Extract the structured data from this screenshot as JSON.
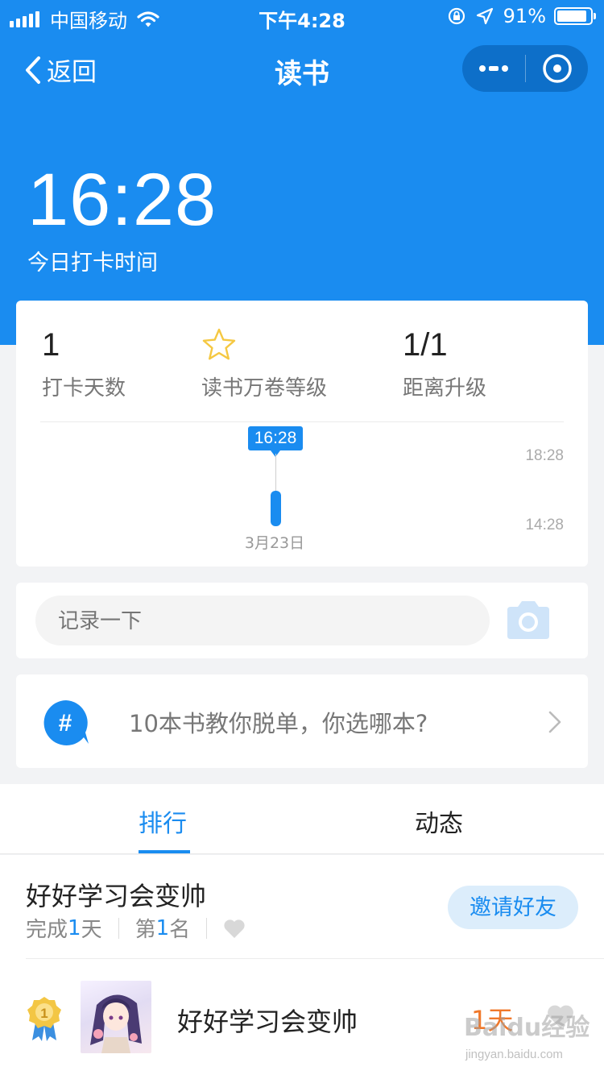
{
  "status_bar": {
    "carrier": "中国移动",
    "time": "下午4:28",
    "battery": "91%",
    "battery_level": 0.91
  },
  "nav": {
    "back_label": "返回",
    "title": "读书"
  },
  "hero": {
    "time": "16:28",
    "subtitle": "今日打卡时间"
  },
  "stats": [
    {
      "value": "1",
      "label": "打卡天数"
    },
    {
      "value": "",
      "label": "读书万卷等级",
      "icon": "star-icon"
    },
    {
      "value": "1/1",
      "label": "距离升级"
    }
  ],
  "chart_data": {
    "type": "bar",
    "categories": [
      "3月23日"
    ],
    "values": [
      "16:28"
    ],
    "data_label": "16:28",
    "y_ticks": [
      "18:28",
      "14:28"
    ]
  },
  "record": {
    "placeholder": "记录一下"
  },
  "topic": {
    "text": "10本书教你脱单，你选哪本?"
  },
  "tabs": [
    {
      "label": "排行",
      "active": true
    },
    {
      "label": "动态",
      "active": false
    }
  ],
  "user": {
    "name": "好好学习会变帅",
    "done_prefix": "完成",
    "done_value": "1",
    "done_suffix": "天",
    "rank_prefix": "第",
    "rank_value": "1",
    "rank_suffix": "名",
    "invite_label": "邀请好友"
  },
  "ranking": [
    {
      "rank": "1",
      "name": "好好学习会变帅",
      "days": "1天"
    }
  ],
  "watermark": {
    "main": "Baidu经验",
    "sub": "jingyan.baidu.com"
  },
  "colors": {
    "primary": "#1a8cf0",
    "accent": "#f0782a"
  }
}
